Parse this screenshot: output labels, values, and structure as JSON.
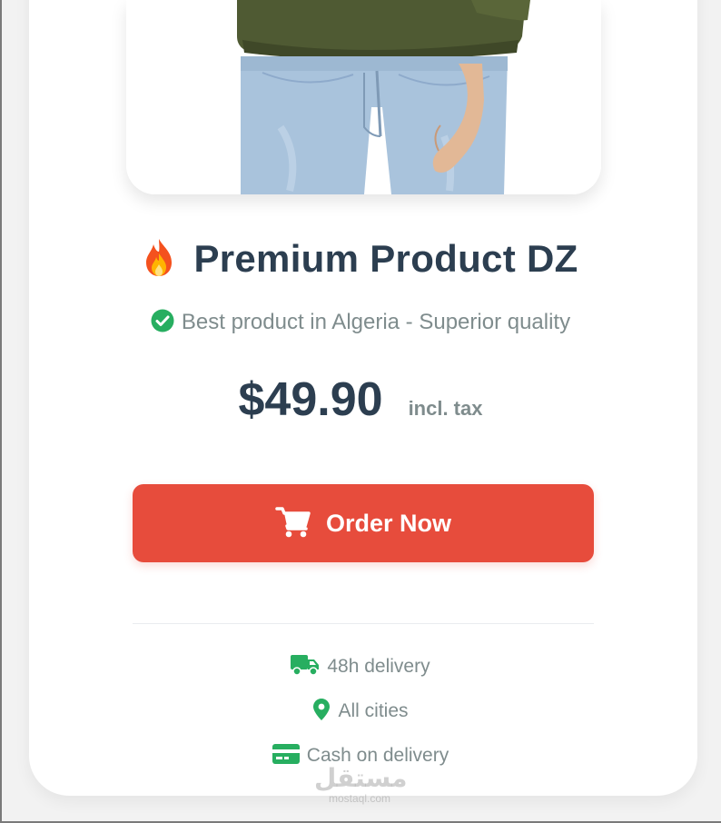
{
  "product": {
    "title": "Premium Product DZ",
    "tagline": "Best product in Algeria - Superior quality",
    "price": "$49.90",
    "tax_note": "incl. tax"
  },
  "order_button": {
    "label": "Order Now"
  },
  "features": [
    {
      "icon": "truck-icon",
      "label": "48h delivery"
    },
    {
      "icon": "map-pin-icon",
      "label": "All cities"
    },
    {
      "icon": "credit-card-icon",
      "label": "Cash on delivery"
    }
  ],
  "watermark": {
    "arabic": "مستقل",
    "latin": "mostaql.com"
  },
  "colors": {
    "title": "#2c3e50",
    "muted": "#7f8c8d",
    "accent_red": "#e74c3c",
    "check_green": "#27ae60",
    "feature_green": "#27ae60"
  },
  "icons": {
    "title_icon": "fire-icon",
    "tagline_icon": "check-circle-icon",
    "button_icon": "cart-icon"
  }
}
